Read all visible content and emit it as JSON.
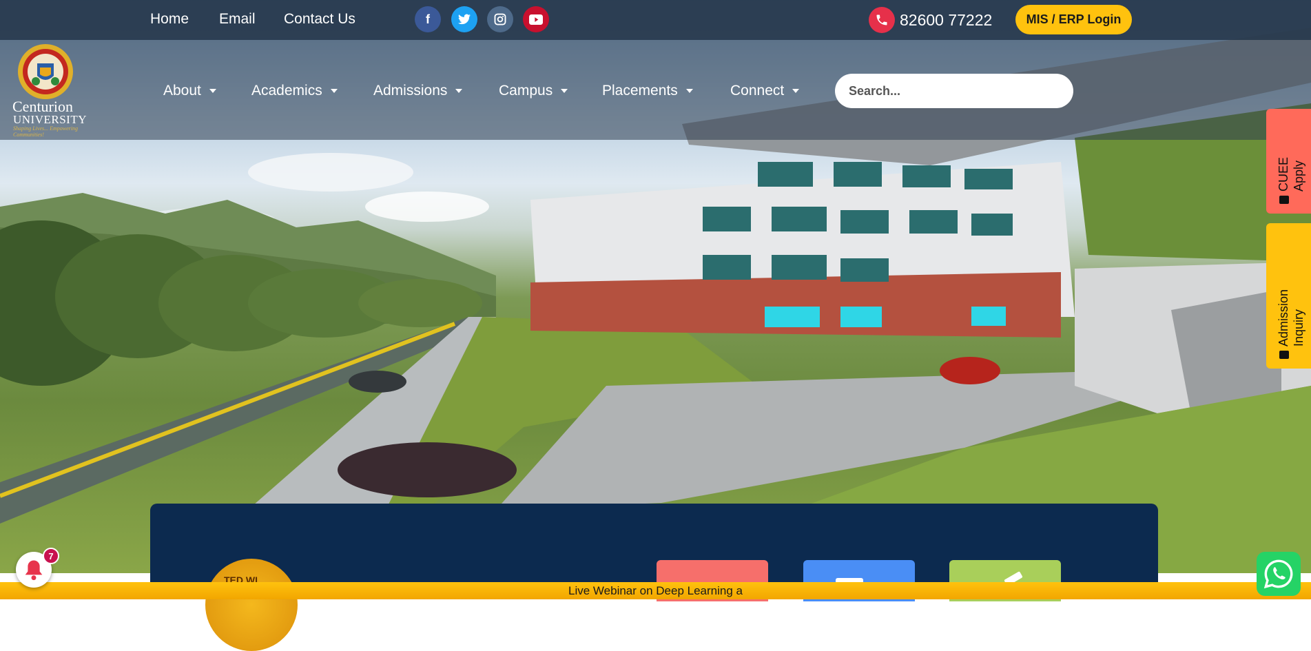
{
  "topbar": {
    "links": [
      "Home",
      "Email",
      "Contact Us"
    ],
    "social": [
      {
        "icon": "facebook-icon",
        "glyph": "f",
        "color": "#3b5998"
      },
      {
        "icon": "twitter-icon",
        "glyph": "t",
        "color": "#1da1f2"
      },
      {
        "icon": "instagram-icon",
        "glyph": "◎",
        "color": "#4e6a8a"
      },
      {
        "icon": "youtube-icon",
        "glyph": "▶",
        "color": "#c8102e"
      }
    ],
    "phone": "82600 77222",
    "erp_label": "MIS / ERP Login"
  },
  "logo": {
    "line1": "Centurion",
    "line2": "UNIVERSITY",
    "tagline": "Shaping Lives... Empowering Communities!"
  },
  "nav": {
    "items": [
      "About",
      "Academics",
      "Admissions",
      "Campus",
      "Placements",
      "Connect"
    ],
    "search_placeholder": "Search..."
  },
  "sidetabs": [
    {
      "line1": "CUEE",
      "line2": "Apply",
      "color": "#ff6a5a"
    },
    {
      "line1": "Admission",
      "line2": "Inquiry",
      "color": "#ffc20e"
    }
  ],
  "card": {
    "badge_text": "TED WI",
    "tiles": [
      "#f66f6b",
      "#4a8ef5",
      "#a9cf5a"
    ]
  },
  "ticker": {
    "text": "Live Webinar on Deep Learning a"
  },
  "notifications": {
    "count": "7"
  },
  "colors": {
    "accent": "#ffc20e",
    "topbar": "#26374b",
    "card": "#0c2a4f"
  }
}
